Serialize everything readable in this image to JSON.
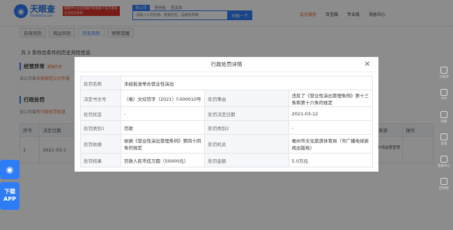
{
  "header": {
    "logo_cn": "天眼查",
    "logo_en": "TianYanCha.com",
    "promo": "国家中小企业发展子基金旗下官方备案企业征信机构",
    "search_tabs": [
      "查公司",
      "查老板",
      "查关系"
    ],
    "search_placeholder": "请输入公司名称、老板姓名、品牌名称等",
    "search_button": "天眼一下",
    "nav": [
      "会员服务",
      "百宝箱",
      "专业版",
      "消息中心"
    ]
  },
  "risk_tabs": [
    "自身风险",
    "周边风险",
    "历史风险",
    "预警提醒"
  ],
  "summary": "共 2 条符合条件的历史风险信息",
  "sections": [
    {
      "title": "经营异常",
      "tag": "清除历史",
      "note_prefix": "该公司曾",
      "note_hl": "未按规定公示年报",
      "note_suffix": ""
    },
    {
      "title": "行政处罚",
      "tag": "",
      "note_prefix": "该公司曾",
      "note_hl": "有行政处罚信息",
      "note_suffix": ""
    }
  ],
  "bg_table": {
    "headers": [
      "序号",
      "决定日期",
      "",
      "",
      "",
      "",
      "",
      "数据来源",
      "操作"
    ],
    "row": [
      "1",
      "2021-03-1",
      "",
      "",
      "",
      "",
      "",
      "国家市场监督管理总局",
      ""
    ]
  },
  "side": {
    "download_label": "下载APP",
    "right_items": [
      "小程序",
      "APP",
      "快报",
      "反馈",
      "客服中心",
      "回顶部"
    ]
  },
  "modal": {
    "title": "行政处罚详情",
    "close": "×",
    "rows": [
      {
        "k1": "处罚名称",
        "v1": "未经批准举办营业性演出",
        "k2": "",
        "v2": ""
      },
      {
        "k1": "决定书文号",
        "v1": "（亳）文综罚字（2021）f-000010号",
        "k2": "处罚事由",
        "v2": "违反了《营业性演出管理条例》第十三条和第十六条的规定"
      },
      {
        "k1": "处罚状态",
        "v1": "-",
        "k2": "处罚决定日期",
        "v2": "2021-03-12"
      },
      {
        "k1": "处罚类别1",
        "v1": "罚款",
        "k2": "处罚类别2",
        "v2": "-"
      },
      {
        "k1": "处罚依据",
        "v1": "依据《营业性演出管理条例》第四十四条的规定",
        "k2": "处罚机关",
        "v2": "亳州市文化旅游体育局（市广播电视新闻出版局）"
      },
      {
        "k1": "处罚结果",
        "v1": "罚款人民币伍万圆（50000元）",
        "k2": "处罚金额",
        "v2": "5.0万元"
      }
    ]
  }
}
